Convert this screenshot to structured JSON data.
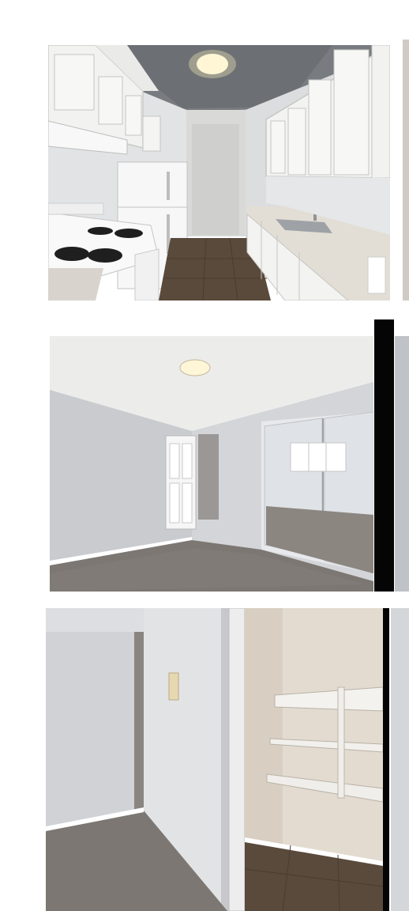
{
  "gallery": {
    "photos": [
      {
        "name": "kitchen-photo"
      },
      {
        "name": "bedroom-photo"
      },
      {
        "name": "closet-photo"
      }
    ]
  },
  "colors": {
    "background": "#ffffff",
    "wall": "#e6e7e8",
    "cabinet": "#f4f4f2",
    "ceiling": "#7b7f84",
    "carpet": "#7c7772",
    "tile": "#5a4a3c",
    "divider": "#050505"
  }
}
